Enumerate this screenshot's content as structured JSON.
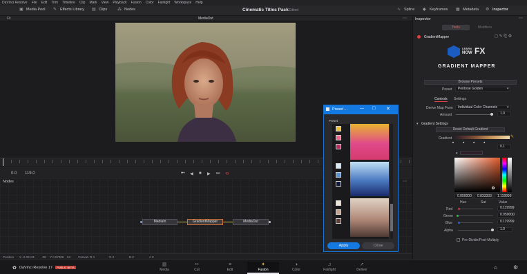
{
  "menu": {
    "items": [
      "DaVinci Resolve",
      "File",
      "Edit",
      "Trim",
      "Timeline",
      "Clip",
      "Mark",
      "View",
      "Playback",
      "Fusion",
      "Color",
      "Fairlight",
      "Workspace",
      "Help"
    ]
  },
  "toolbar": {
    "media_pool": "Media Pool",
    "effects_library": "Effects Library",
    "clips": "Clips",
    "nodes": "Nodes",
    "spline": "Spline",
    "keyframes": "Keyframes",
    "metadata": "Metadata",
    "inspector": "Inspector"
  },
  "project": {
    "title": "Cinematic Titles Pack",
    "status": "Edited"
  },
  "viewer": {
    "label": "MediaOut",
    "fit": "Fit"
  },
  "transport": {
    "start": "0.0",
    "end": "119.0"
  },
  "nodes_panel": {
    "label": "Nodes",
    "nodes": [
      "MediaIn",
      "GradientMapper",
      "MediaOut"
    ]
  },
  "status_bar": {
    "position_label": "Position",
    "x": "X -0.02131",
    "xv": "-39",
    "y": "Y 0.07306",
    "yv": "94",
    "canvas": "Canvas",
    "r": "R 0",
    "g": "G 0",
    "b": "B 0",
    "a": "A 0",
    "mem": "19% - 1421 MB"
  },
  "pages": {
    "app": "DaVinci Resolve 17",
    "badge": "PUBLIC BETA",
    "items": [
      "Media",
      "Cut",
      "Edit",
      "Fusion",
      "Color",
      "Fairlight",
      "Deliver"
    ],
    "active": "Fusion"
  },
  "inspector": {
    "title": "Inspector",
    "tab_tools": "Tools",
    "tab_modifiers": "Modifiers",
    "tool_name": "GradientMapper",
    "logo_learn": "LEARN",
    "logo_now": "NOW",
    "logo_fx": "FX",
    "logo_sub": "GRADIENT MAPPER",
    "browse_presets": "Browse Presets",
    "preset_label": "Preset",
    "preset_value": "Pentone Golden",
    "tab_controls": "Controls",
    "tab_settings": "Settings",
    "derive_label": "Derive Map From",
    "derive_value": "Individual Color Channels",
    "amount_label": "Amount",
    "amount_value": "1.0",
    "gradient_settings": "Gradient Settings",
    "reset_gradient": "Reset Default Gradient",
    "gradient_label": "Gradient",
    "gradient_pos": "0.1",
    "hue_val": "0.050000",
    "sat_val": "0.833333",
    "value_val": "1.119999",
    "hue_label": "Hue",
    "sat_label": "Sat",
    "value_label": "Value",
    "red_label": "Red",
    "red_value": "0.119999",
    "green_label": "Green",
    "green_value": "0.050000",
    "blue_label": "Blue",
    "blue_value": "0.119999",
    "alpha_label": "Alpha",
    "alpha_value": "1.0",
    "premult": "Pre-Divide/Post-Multiply"
  },
  "preset_window": {
    "title": "Preset ...",
    "section": "Preset",
    "apply": "Apply",
    "close": "Close"
  },
  "colors": {
    "accent": "#1479e0",
    "fusion_active": "#f0c040",
    "node_selected": "#d7733a"
  }
}
